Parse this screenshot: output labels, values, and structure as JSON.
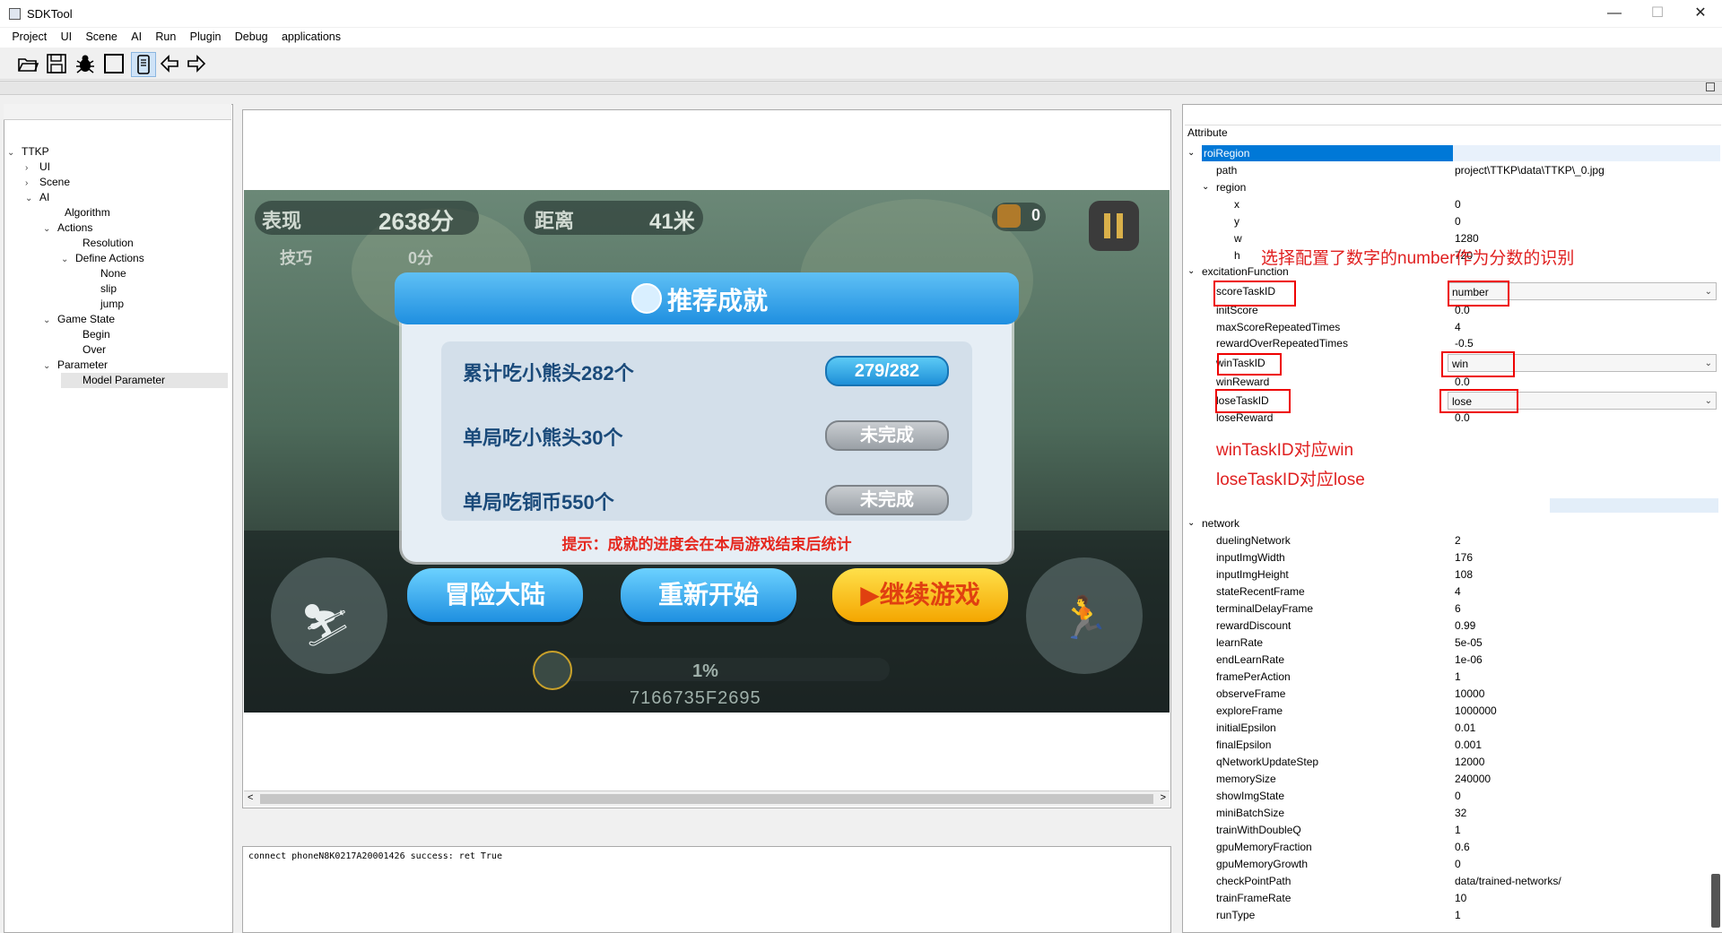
{
  "window": {
    "title": "SDKTool",
    "min_label": "—",
    "max_label": "☐",
    "close_label": "✕"
  },
  "menu": [
    "Project",
    "UI",
    "Scene",
    "AI",
    "Run",
    "Plugin",
    "Debug",
    "applications"
  ],
  "toolbar": {
    "icons": [
      "open-folder-icon",
      "save-icon",
      "debug-bug-icon",
      "blank-square-icon",
      "phone-icon",
      "back-arrow-icon",
      "forward-arrow-icon"
    ]
  },
  "tree": {
    "items": [
      {
        "label": "TTKP",
        "level": 0,
        "expanded": true
      },
      {
        "label": "UI",
        "level": 1,
        "expanded": false
      },
      {
        "label": "Scene",
        "level": 1,
        "expanded": false
      },
      {
        "label": "AI",
        "level": 1,
        "expanded": true
      },
      {
        "label": "Algorithm",
        "level": 2,
        "expanded": null
      },
      {
        "label": "Actions",
        "level": 2,
        "expanded": true
      },
      {
        "label": "Resolution",
        "level": 3,
        "expanded": null
      },
      {
        "label": "Define Actions",
        "level": 3,
        "expanded": true
      },
      {
        "label": "None",
        "level": 4,
        "expanded": null
      },
      {
        "label": "slip",
        "level": 4,
        "expanded": null
      },
      {
        "label": "jump",
        "level": 4,
        "expanded": null
      },
      {
        "label": "Game State",
        "level": 2,
        "expanded": true
      },
      {
        "label": "Begin",
        "level": 3,
        "expanded": null
      },
      {
        "label": "Over",
        "level": 3,
        "expanded": null
      },
      {
        "label": "Parameter",
        "level": 2,
        "expanded": true
      },
      {
        "label": "Model Parameter",
        "level": 3,
        "expanded": null,
        "selected": true
      }
    ]
  },
  "game": {
    "hud": {
      "perf_label": "表现",
      "perf_value": "2638分",
      "skill_label": "技巧",
      "skill_value": "0分",
      "dist_label": "距离",
      "dist_value": "41米",
      "gem_count": "0"
    },
    "popup": {
      "title": "推荐成就",
      "rows": [
        {
          "label": "累计吃小熊头282个",
          "status": "279/282",
          "done": false,
          "progress": true
        },
        {
          "label": "单局吃小熊头30个",
          "status": "未完成",
          "done": false,
          "progress": false
        },
        {
          "label": "单局吃铜币550个",
          "status": "未完成",
          "done": false,
          "progress": false
        }
      ],
      "hint": "提示：成就的进度会在本局游戏结束后统计"
    },
    "buttons": {
      "adventure": "冒险大陆",
      "restart": "重新开始",
      "continue": "▶继续游戏"
    },
    "footer": {
      "percent": "1%",
      "code": "7166735F2695"
    }
  },
  "log": {
    "text": "connect phoneN8K0217A20001426 success: ret True"
  },
  "attributes": {
    "header": "Attribute",
    "rows": [
      {
        "key": "roiRegion",
        "val": "",
        "level": 0,
        "exp": "open",
        "selected": true
      },
      {
        "key": "path",
        "val": "project\\TTKP\\data\\TTKP\\_0.jpg",
        "level": 1,
        "exp": null
      },
      {
        "key": "region",
        "val": "",
        "level": 1,
        "exp": "open"
      },
      {
        "key": "x",
        "val": "0",
        "level": 2,
        "exp": null
      },
      {
        "key": "y",
        "val": "0",
        "level": 2,
        "exp": null
      },
      {
        "key": "w",
        "val": "1280",
        "level": 2,
        "exp": null
      },
      {
        "key": "h",
        "val": "720",
        "level": 2,
        "exp": null
      },
      {
        "key": "excitationFunction",
        "val": "",
        "level": 0,
        "exp": "open"
      },
      {
        "key": "scoreTaskID",
        "val": "number",
        "level": 1,
        "exp": null,
        "combo": true
      },
      {
        "key": "initScore",
        "val": "0.0",
        "level": 1,
        "exp": null
      },
      {
        "key": "maxScoreRepeatedTimes",
        "val": "4",
        "level": 1,
        "exp": null
      },
      {
        "key": "rewardOverRepeatedTimes",
        "val": "-0.5",
        "level": 1,
        "exp": null
      },
      {
        "key": "winTaskID",
        "val": "win",
        "level": 1,
        "exp": null,
        "combo": true
      },
      {
        "key": "winReward",
        "val": "0.0",
        "level": 1,
        "exp": null
      },
      {
        "key": "loseTaskID",
        "val": "lose",
        "level": 1,
        "exp": null,
        "combo": true
      },
      {
        "key": "loseReward",
        "val": "0.0",
        "level": 1,
        "exp": null
      },
      {
        "key": "network",
        "val": "",
        "level": 0,
        "exp": "open"
      },
      {
        "key": "duelingNetwork",
        "val": "2",
        "level": 1,
        "exp": null
      },
      {
        "key": "inputImgWidth",
        "val": "176",
        "level": 1,
        "exp": null
      },
      {
        "key": "inputImgHeight",
        "val": "108",
        "level": 1,
        "exp": null
      },
      {
        "key": "stateRecentFrame",
        "val": "4",
        "level": 1,
        "exp": null
      },
      {
        "key": "terminalDelayFrame",
        "val": "6",
        "level": 1,
        "exp": null
      },
      {
        "key": "rewardDiscount",
        "val": "0.99",
        "level": 1,
        "exp": null
      },
      {
        "key": "learnRate",
        "val": "5e-05",
        "level": 1,
        "exp": null
      },
      {
        "key": "endLearnRate",
        "val": "1e-06",
        "level": 1,
        "exp": null
      },
      {
        "key": "framePerAction",
        "val": "1",
        "level": 1,
        "exp": null
      },
      {
        "key": "observeFrame",
        "val": "10000",
        "level": 1,
        "exp": null
      },
      {
        "key": "exploreFrame",
        "val": "1000000",
        "level": 1,
        "exp": null
      },
      {
        "key": "initialEpsilon",
        "val": "0.01",
        "level": 1,
        "exp": null
      },
      {
        "key": "finalEpsilon",
        "val": "0.001",
        "level": 1,
        "exp": null
      },
      {
        "key": "qNetworkUpdateStep",
        "val": "12000",
        "level": 1,
        "exp": null
      },
      {
        "key": "memorySize",
        "val": "240000",
        "level": 1,
        "exp": null
      },
      {
        "key": "showImgState",
        "val": "0",
        "level": 1,
        "exp": null
      },
      {
        "key": "miniBatchSize",
        "val": "32",
        "level": 1,
        "exp": null
      },
      {
        "key": "trainWithDoubleQ",
        "val": "1",
        "level": 1,
        "exp": null
      },
      {
        "key": "gpuMemoryFraction",
        "val": "0.6",
        "level": 1,
        "exp": null
      },
      {
        "key": "gpuMemoryGrowth",
        "val": "0",
        "level": 1,
        "exp": null
      },
      {
        "key": "checkPointPath",
        "val": "data/trained-networks/",
        "level": 1,
        "exp": null
      },
      {
        "key": "trainFrameRate",
        "val": "10",
        "level": 1,
        "exp": null
      },
      {
        "key": "runType",
        "val": "1",
        "level": 1,
        "exp": null
      }
    ]
  },
  "annotations": {
    "score_note": "选择配置了数字的number作为分数的识别",
    "win_note": "winTaskID对应win",
    "lose_note": "loseTaskID对应lose"
  },
  "colors": {
    "annotation": "#e02020",
    "selection": "#0078d7",
    "popup_blue": "#1f8fe0",
    "continue_yellow": "#f4b400"
  }
}
